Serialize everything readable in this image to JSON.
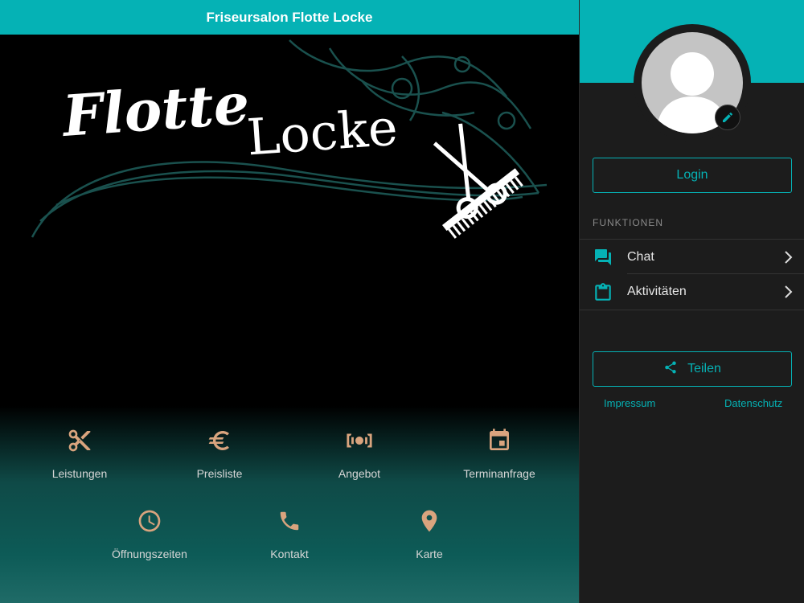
{
  "header": {
    "title": "Friseursalon Flotte Locke"
  },
  "logo": {
    "word1": "Flotte",
    "word2": "Locke"
  },
  "tiles": [
    {
      "label": "Leistungen",
      "icon": "scissors-icon"
    },
    {
      "label": "Preisliste",
      "icon": "euro-icon"
    },
    {
      "label": "Angebot",
      "icon": "money-icon"
    },
    {
      "label": "Terminanfrage",
      "icon": "calendar-icon"
    },
    {
      "label": "Öffnungszeiten",
      "icon": "clock-icon"
    },
    {
      "label": "Kontakt",
      "icon": "phone-icon"
    },
    {
      "label": "Karte",
      "icon": "map-pin-icon"
    }
  ],
  "sidebar": {
    "login_label": "Login",
    "section_title": "FUNKTIONEN",
    "items": [
      {
        "label": "Chat",
        "icon": "chat-icon"
      },
      {
        "label": "Aktivitäten",
        "icon": "clipboard-icon"
      }
    ],
    "share_label": "Teilen",
    "footer": {
      "impressum": "Impressum",
      "datenschutz": "Datenschutz"
    }
  },
  "colors": {
    "accent": "#05b2b5",
    "icon_tan": "#d9a47e",
    "background": "#000000",
    "sidebar": "#1c1c1c"
  }
}
